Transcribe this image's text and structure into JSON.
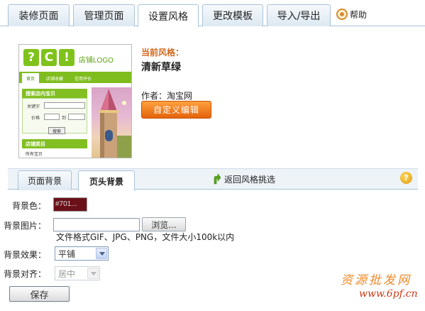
{
  "top_tabs": [
    {
      "label": "装修页面",
      "active": false
    },
    {
      "label": "管理页面",
      "active": false
    },
    {
      "label": "设置风格",
      "active": true
    },
    {
      "label": "更改模板",
      "active": false
    },
    {
      "label": "导入/导出",
      "active": false
    }
  ],
  "help_label": "帮助",
  "preview": {
    "logo_letters": [
      "?",
      "C",
      "!"
    ],
    "logo_text": "店铺LOGO",
    "nav": [
      "首页",
      "店铺收藏",
      "信用评价"
    ],
    "search_title": "搜索店内宝贝",
    "keyword_label": "关键字",
    "price_label": "价格",
    "price_to": "到",
    "search_button": "搜索",
    "category_title": "店铺类目",
    "category_item": "所有宝贝"
  },
  "style_info": {
    "current_label": "当前风格：",
    "current_name": "清新草绿",
    "author": "作者：淘宝网",
    "custom_edit_button": "自定义编辑"
  },
  "sub_tabs": [
    {
      "label": "页面背景",
      "active": false
    },
    {
      "label": "页头背景",
      "active": true
    }
  ],
  "back_link": "返回风格挑选",
  "form": {
    "bg_color_label": "背景色：",
    "bg_color_value": "#701...",
    "bg_image_label": "背景图片：",
    "browse_button": "浏览...",
    "file_hint": "文件格式GIF、JPG、PNG，文件大小100k以内",
    "bg_effect_label": "背景效果：",
    "bg_effect_value": "平铺",
    "bg_align_label": "背景对齐：",
    "bg_align_value": "居中",
    "save_button": "保存"
  },
  "watermark": {
    "text": "资源批发网",
    "url": "www.6pf.cn"
  },
  "colors": {
    "accent": "#e4620a",
    "current_label": "#d4681c",
    "preview_green": "#7fbd1e",
    "swatch": "#6b1018",
    "tab_border": "#a9c3d9"
  }
}
